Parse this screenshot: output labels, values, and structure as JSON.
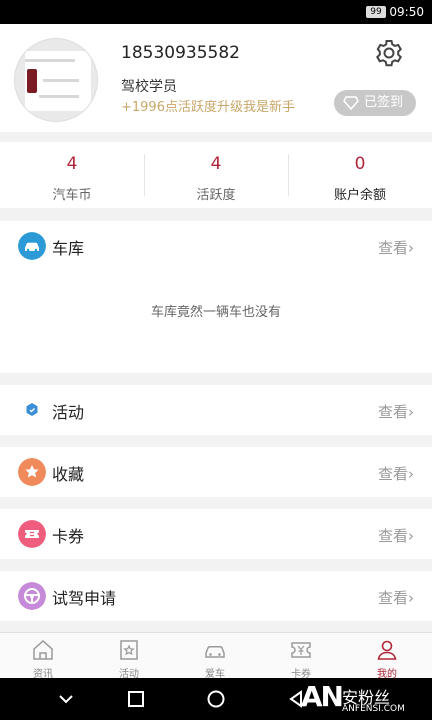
{
  "status_bar": {
    "battery": "99",
    "time": "09:50"
  },
  "profile": {
    "phone": "18530935582",
    "role": "驾校学员",
    "promo": "+1996点活跃度升级我是新手",
    "signed_label": "已签到"
  },
  "stats": [
    {
      "value": "4",
      "label": "汽车币"
    },
    {
      "value": "4",
      "label": "活跃度"
    },
    {
      "value": "0",
      "label": "账户余额"
    }
  ],
  "garage": {
    "title": "车库",
    "more": "查看",
    "empty_text": "车库竟然一辆车也没有"
  },
  "menu": [
    {
      "title": "活动",
      "more": "查看"
    },
    {
      "title": "收藏",
      "more": "查看"
    },
    {
      "title": "卡券",
      "more": "查看"
    },
    {
      "title": "试驾申请",
      "more": "查看"
    }
  ],
  "tabs": [
    {
      "label": "资讯"
    },
    {
      "label": "活动"
    },
    {
      "label": "爱车"
    },
    {
      "label": "卡券"
    },
    {
      "label": "我的"
    }
  ],
  "watermark": {
    "logo": "AN",
    "cn": "安粉丝",
    "en": "ANFENSI.COM"
  },
  "colors": {
    "accent": "#b2263a",
    "promo": "#c9a76a",
    "garage_icon": "#2d9ad8",
    "activity_icon": "#3a8ed8",
    "favorite_icon": "#f08a5a",
    "coupon_icon": "#ef5d7e",
    "testdrive_icon": "#c58ad8"
  }
}
